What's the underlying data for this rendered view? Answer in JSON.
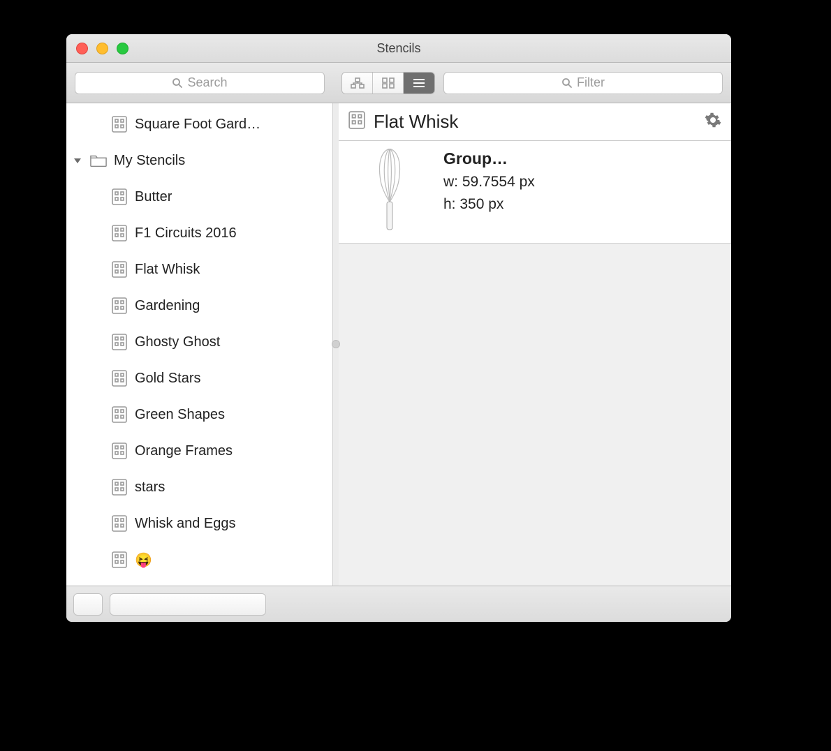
{
  "window": {
    "title": "Stencils"
  },
  "search": {
    "placeholder": "Search"
  },
  "filter": {
    "placeholder": "Filter"
  },
  "sidebar": {
    "partial_item": {
      "label": "Square Foot Gard…"
    },
    "folder": {
      "label": "My Stencils"
    },
    "items": [
      {
        "label": "Butter"
      },
      {
        "label": "F1 Circuits 2016"
      },
      {
        "label": "Flat Whisk"
      },
      {
        "label": "Gardening"
      },
      {
        "label": "Ghosty Ghost"
      },
      {
        "label": "Gold Stars"
      },
      {
        "label": "Green Shapes"
      },
      {
        "label": "Orange Frames"
      },
      {
        "label": "stars"
      },
      {
        "label": "Whisk and Eggs"
      },
      {
        "label": "😝"
      }
    ]
  },
  "content": {
    "title": "Flat Whisk",
    "item": {
      "name": "Group…",
      "width": "w: 59.7554 px",
      "height": "h: 350 px"
    }
  }
}
